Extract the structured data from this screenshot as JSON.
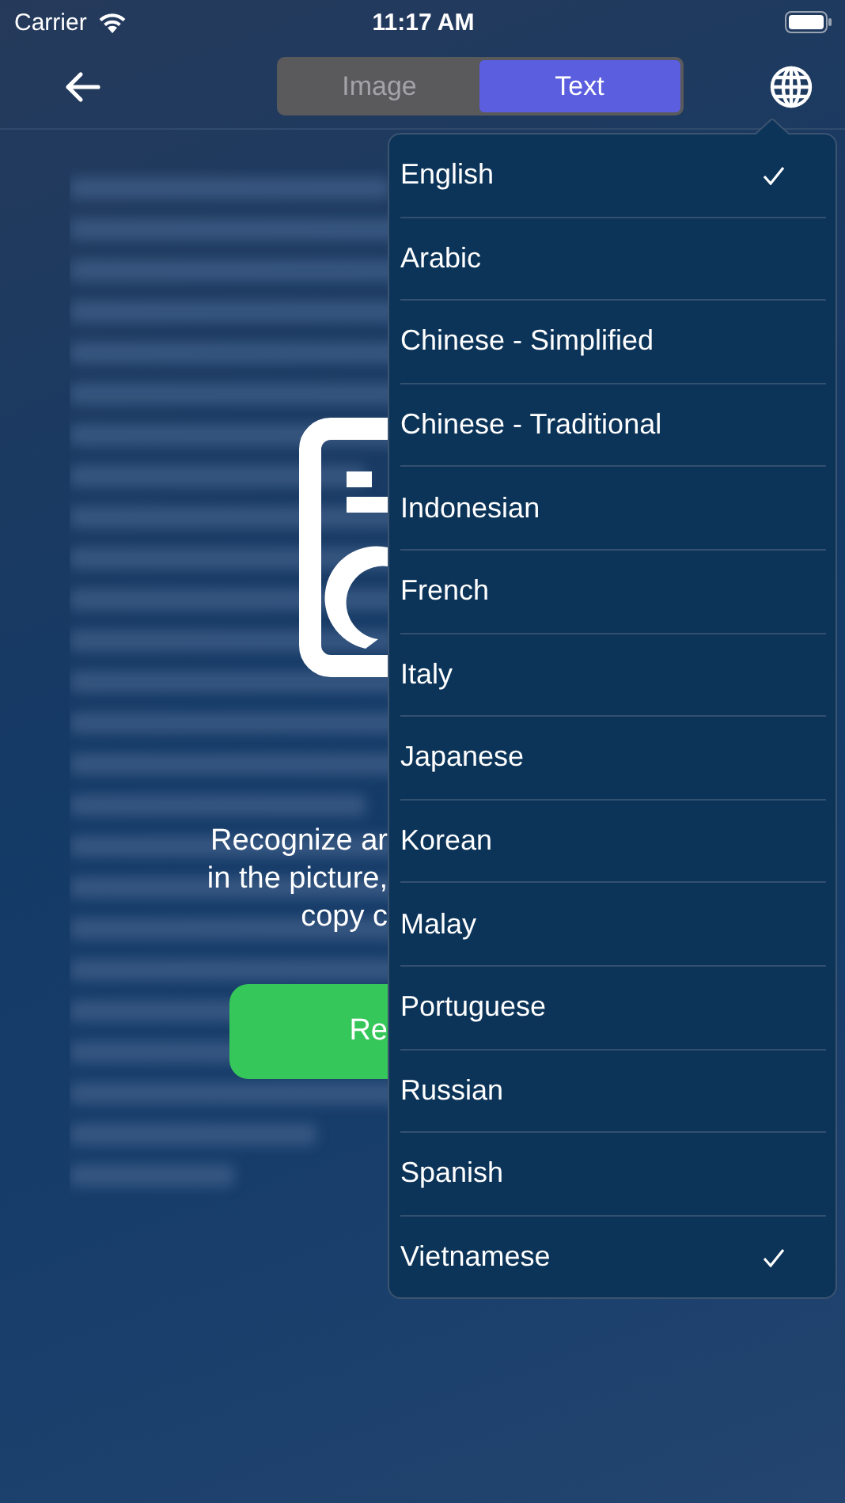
{
  "status_bar": {
    "carrier": "Carrier",
    "time": "11:17 AM"
  },
  "segments": [
    {
      "label": "Image",
      "selected": false
    },
    {
      "label": "Text",
      "selected": true
    }
  ],
  "intro": {
    "lines": [
      "Recognize ar",
      "in the picture,",
      "copy c"
    ],
    "button": "Re"
  },
  "languages": [
    {
      "label": "English",
      "checked": true
    },
    {
      "label": "Arabic",
      "checked": false
    },
    {
      "label": "Chinese - Simplified",
      "checked": false
    },
    {
      "label": "Chinese - Traditional",
      "checked": false
    },
    {
      "label": "Indonesian",
      "checked": false
    },
    {
      "label": "French",
      "checked": false
    },
    {
      "label": "Italy",
      "checked": false
    },
    {
      "label": "Japanese",
      "checked": false
    },
    {
      "label": "Korean",
      "checked": false
    },
    {
      "label": "Malay",
      "checked": false
    },
    {
      "label": "Portuguese",
      "checked": false
    },
    {
      "label": "Russian",
      "checked": false
    },
    {
      "label": "Spanish",
      "checked": false
    },
    {
      "label": "Vietnamese",
      "checked": true
    }
  ]
}
